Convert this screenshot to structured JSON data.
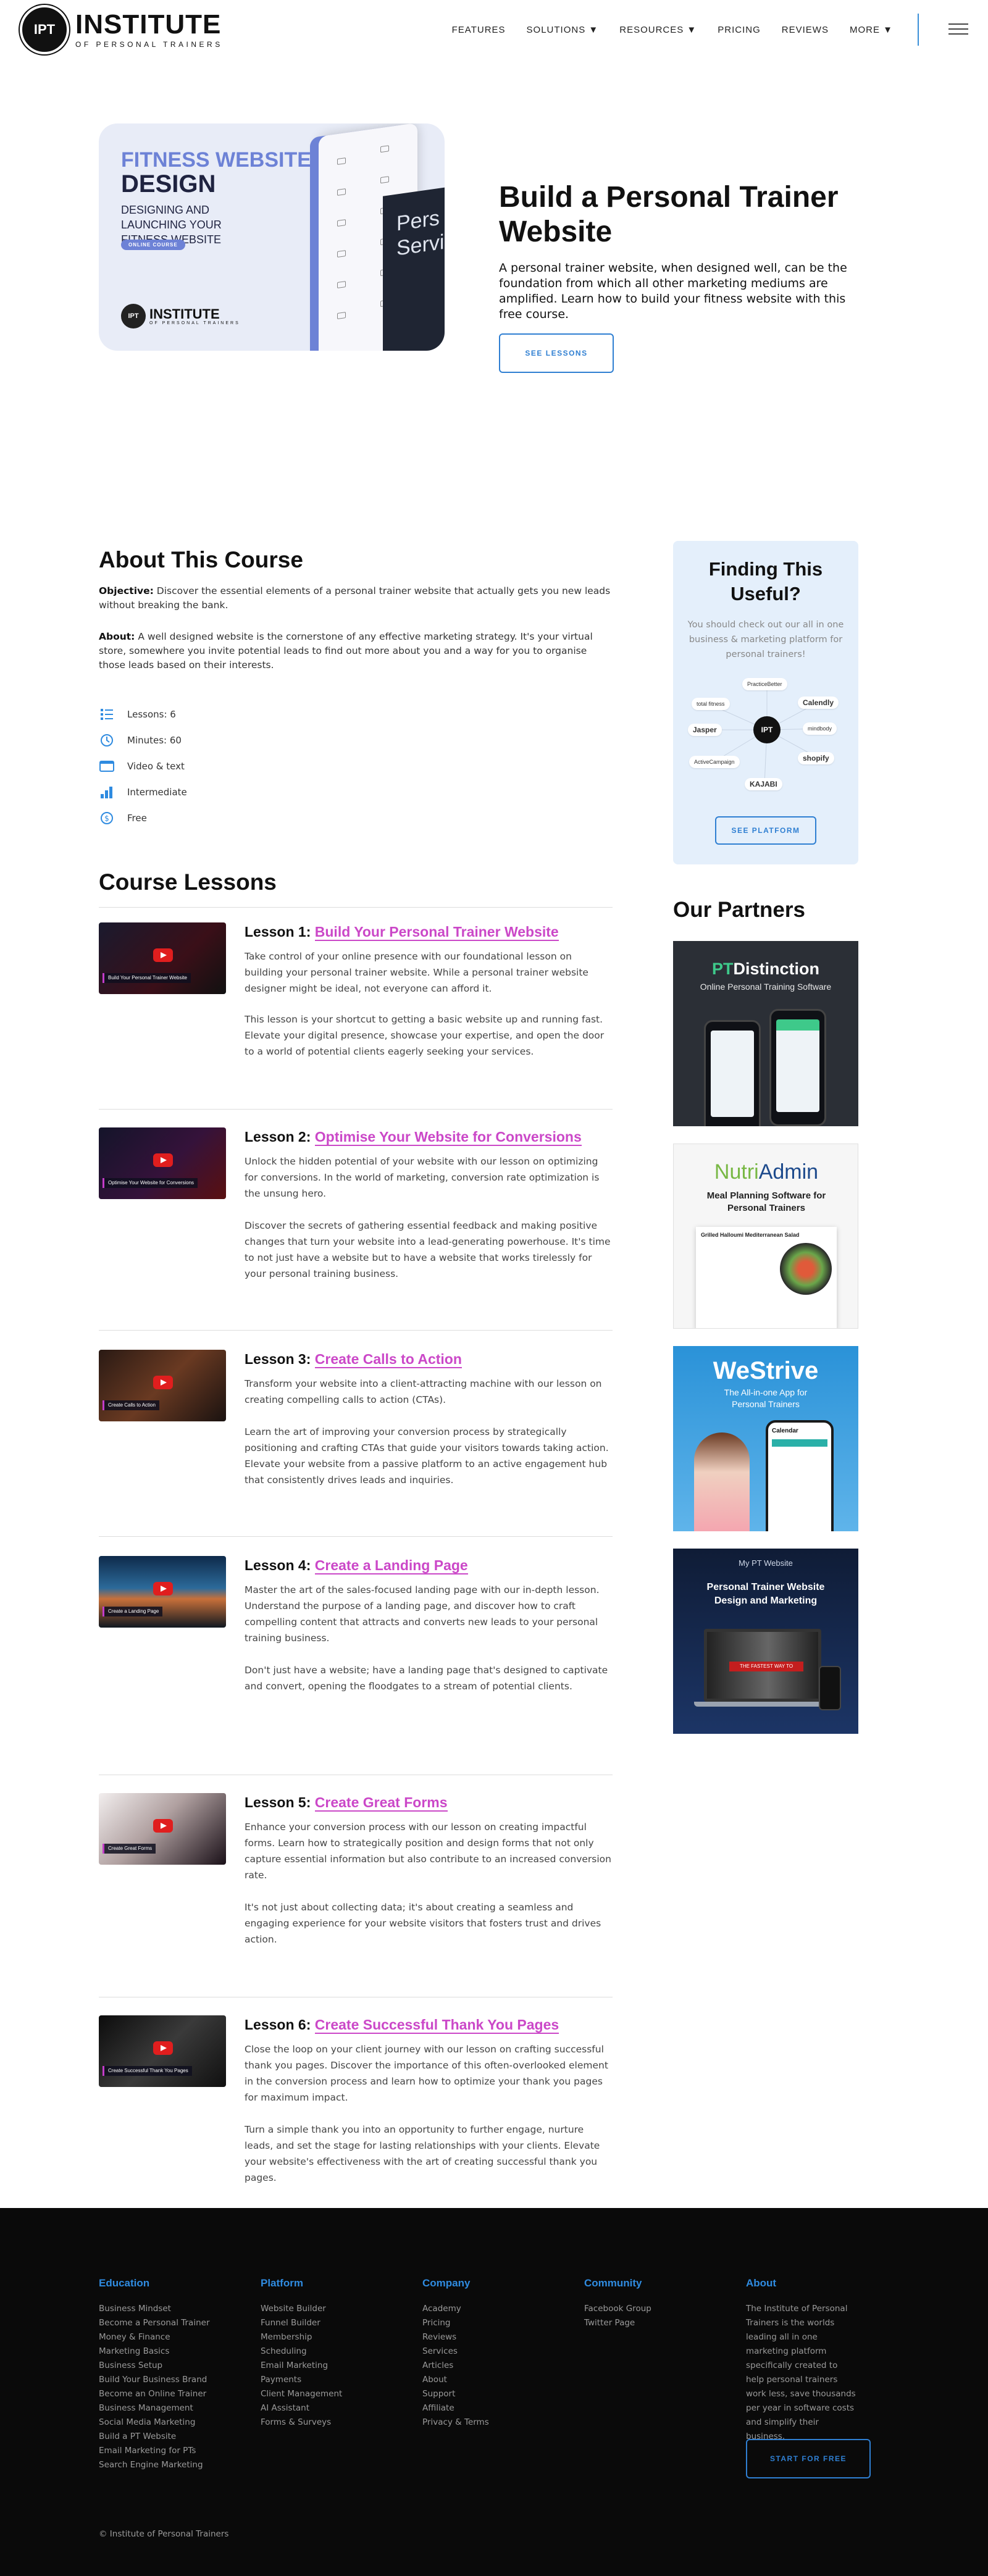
{
  "header": {
    "logo_badge": "IPT",
    "logo_main": "INSTITUTE",
    "logo_sub": "OF PERSONAL TRAINERS",
    "nav": [
      "FEATURES",
      "SOLUTIONS ▼",
      "RESOURCES ▼",
      "PRICING",
      "REVIEWS",
      "MORE ▼"
    ]
  },
  "hero": {
    "card": {
      "title1": "FITNESS WEBSITE",
      "title2": "DESIGN",
      "subtitle": "DESIGNING AND LAUNCHING YOUR FITNESS WEBSITE",
      "pill": "ONLINE COURSE",
      "logo_main": "INSTITUTE",
      "logo_sub": "OF PERSONAL TRAINERS",
      "screen_text": "Pers Servic"
    },
    "title": "Build a Personal Trainer Website",
    "text": "A personal trainer website, when designed well, can be the foundation from which all other marketing mediums are amplified. Learn how to build your fitness website with this free course.",
    "button": "SEE LESSONS"
  },
  "about": {
    "title": "About This Course",
    "objective_label": "Objective:",
    "objective": "Discover the essential elements of a personal trainer website that actually gets you new leads without breaking the bank.",
    "about_label": "About:",
    "about": "A well designed website is the cornerstone of any effective marketing strategy. It's your virtual store, somewhere you invite potential leads to find out more about you and a way for you to organise those leads based on their interests.",
    "stats": [
      {
        "icon": "list-icon",
        "label": "Lessons: 6"
      },
      {
        "icon": "clock-icon",
        "label": "Minutes: 60"
      },
      {
        "icon": "video-icon",
        "label": "Video & text"
      },
      {
        "icon": "bar-chart-icon",
        "label": "Intermediate"
      },
      {
        "icon": "dollar-icon",
        "label": "Free"
      }
    ]
  },
  "lessons_title": "Course Lessons",
  "lessons": [
    {
      "prefix": "Lesson 1:",
      "name": "Build Your Personal Trainer Website",
      "thumb_caption": "Build Your Personal Trainer Website",
      "p1": "Take control of your online presence with our foundational lesson on building your personal trainer website. While a personal trainer website designer might be ideal, not everyone can afford it.",
      "p2": "This lesson is your shortcut to getting a basic website up and running fast. Elevate your digital presence, showcase your expertise, and open the door to a world of potential clients eagerly seeking your services."
    },
    {
      "prefix": "Lesson 2:",
      "name": "Optimise Your Website for Conversions",
      "thumb_caption": "Optimise Your Website for Conversions",
      "p1": "Unlock the hidden potential of your website with our lesson on optimizing for conversions. In the world of marketing, conversion rate optimization is the unsung hero.",
      "p2": "Discover the secrets of gathering essential feedback and making positive changes that turn your website into a lead-generating powerhouse. It's time to not just have a website but to have a website that works tirelessly for your personal training business."
    },
    {
      "prefix": "Lesson 3:",
      "name": "Create Calls to Action",
      "thumb_caption": "Create Calls to Action",
      "p1": "Transform your website into a client-attracting machine with our lesson on creating compelling calls to action (CTAs).",
      "p2": "Learn the art of improving your conversion process by strategically positioning and crafting CTAs that guide your visitors towards taking action. Elevate your website from a passive platform to an active engagement hub that consistently drives leads and inquiries."
    },
    {
      "prefix": "Lesson 4:",
      "name": "Create a Landing Page",
      "thumb_caption": "Create a Landing Page",
      "p1": "Master the art of the sales-focused landing page with our in-depth lesson. Understand the purpose of a landing page, and discover how to craft compelling content that attracts and converts new leads to your personal training business.",
      "p2": "Don't just have a website; have a landing page that's designed to captivate and convert, opening the floodgates to a stream of potential clients."
    },
    {
      "prefix": "Lesson 5:",
      "name": "Create Great Forms",
      "thumb_caption": "Create Great Forms",
      "p1": "Enhance your conversion process with our lesson on creating impactful forms. Learn how to strategically position and design forms that not only capture essential information but also contribute to an increased conversion rate.",
      "p2": "It's not just about collecting data; it's about creating a seamless and engaging experience for your website visitors that fosters trust and drives action."
    },
    {
      "prefix": "Lesson 6:",
      "name": "Create Successful Thank You Pages",
      "thumb_caption": "Create Successful Thank You Pages",
      "p1": "Close the loop on your client journey with our lesson on crafting successful thank you pages. Discover the importance of this often-overlooked element in the conversion process and learn how to optimize your thank you pages for maximum impact.",
      "p2": "Turn a simple thank you into an opportunity to further engage, nurture leads, and set the stage for lasting relationships with your clients. Elevate your website's effectiveness with the art of creating successful thank you pages."
    }
  ],
  "sidebar": {
    "title": "Finding This Useful?",
    "text": "You should check out our all in one business & marketing platform for personal trainers!",
    "hub": "IPT",
    "nodes": [
      "PracticeBetter",
      "Calendly",
      "mindbody",
      "shopify",
      "KAJABI",
      "ActiveCampaign",
      "Jasper",
      "total fitness"
    ],
    "button": "SEE PLATFORM"
  },
  "partners_title": "Our Partners",
  "partners": [
    {
      "title_accent": "PT",
      "title": "Distinction",
      "subtitle": "Online Personal Training Software"
    },
    {
      "title_accent": "Nutri",
      "title": "Admin",
      "subtitle": "Meal Planning Software for Personal Trainers",
      "card_title": "Grilled Halloumi Mediterranean Salad"
    },
    {
      "title": "WeStrive",
      "subtitle": "The All-in-one App for Personal Trainers",
      "screen": "Calendar"
    },
    {
      "brand": "My PT Website",
      "title": "Personal Trainer Website Design and Marketing",
      "screen": "THE FASTEST WAY TO"
    }
  ],
  "footer": {
    "columns": [
      {
        "title": "Education",
        "items": [
          "Business Mindset",
          "Become a Personal Trainer",
          "Money & Finance",
          "Marketing Basics",
          "Business Setup",
          "Build Your Business Brand",
          "Become an Online Trainer",
          "Business Management",
          "Social Media Marketing",
          "Build a PT Website",
          "Email Marketing for PTs",
          "Search Engine Marketing"
        ]
      },
      {
        "title": "Platform",
        "items": [
          "Website Builder",
          "Funnel Builder",
          "Membership",
          "Scheduling",
          "Email Marketing",
          "Payments",
          "Client Management",
          "AI Assistant",
          "Forms & Surveys"
        ]
      },
      {
        "title": "Company",
        "items": [
          "Academy",
          "Pricing",
          "Reviews",
          "Services",
          "Articles",
          "About",
          "Support",
          "Affiliate",
          "Privacy & Terms"
        ]
      },
      {
        "title": "Community",
        "items": [
          "Facebook Group",
          "Twitter Page"
        ]
      }
    ],
    "about_title": "About",
    "about_text": "The Institute of Personal Trainers is the worlds leading all in one marketing platform specifically created to help personal trainers work less, save thousands per year in software costs and simplify their business.",
    "button": "START FOR FREE",
    "copyright": "© Institute of Personal Trainers"
  }
}
